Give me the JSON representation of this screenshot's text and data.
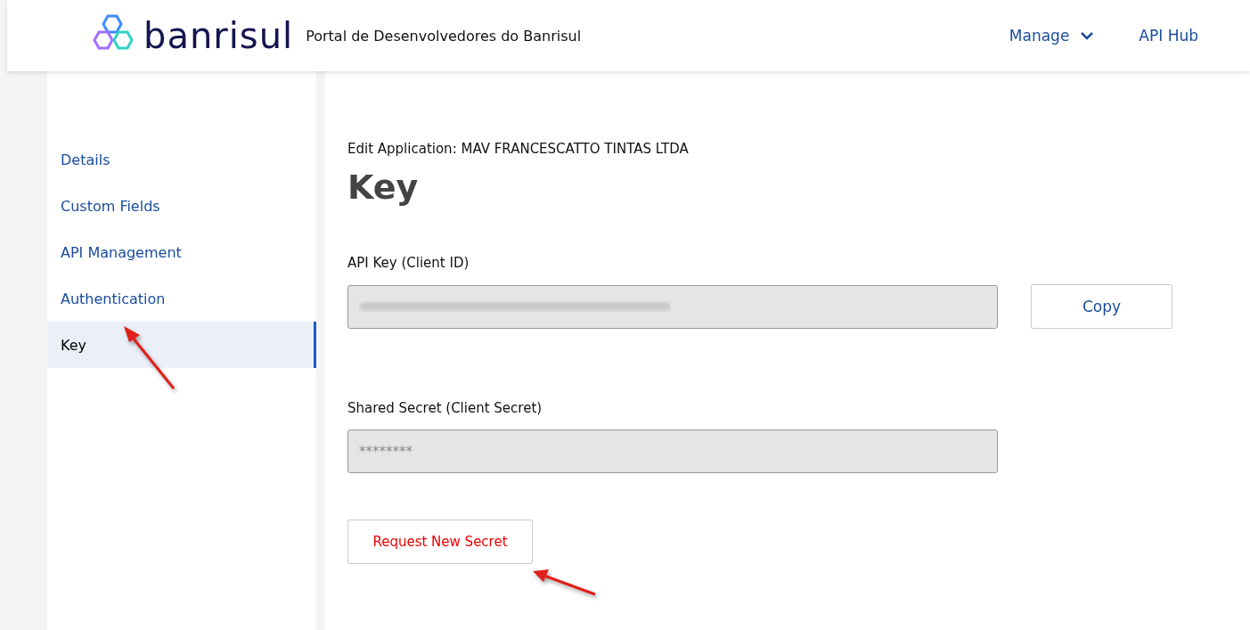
{
  "header": {
    "logo_text": "banrisul",
    "portal_title": "Portal de Desenvolvedores do Banrisul",
    "nav": [
      {
        "label": "Manage",
        "kind": "dropdown"
      },
      {
        "label": "API Hub",
        "kind": "link"
      }
    ]
  },
  "sidebar": {
    "items": [
      {
        "label": "Details",
        "selected": false
      },
      {
        "label": "Custom Fields",
        "selected": false
      },
      {
        "label": "API Management",
        "selected": false
      },
      {
        "label": "Authentication",
        "selected": false
      },
      {
        "label": "Key",
        "selected": true
      }
    ]
  },
  "main": {
    "subtitle": "Edit Application: MAV FRANCESCATTO TINTAS LTDA",
    "title": "Key",
    "api_key": {
      "label": "API Key (Client ID)",
      "value_redacted": true,
      "button": "Copy"
    },
    "secret": {
      "label": "Shared Secret (Client Secret)",
      "value": "********"
    },
    "request_button": "Request New Secret"
  }
}
